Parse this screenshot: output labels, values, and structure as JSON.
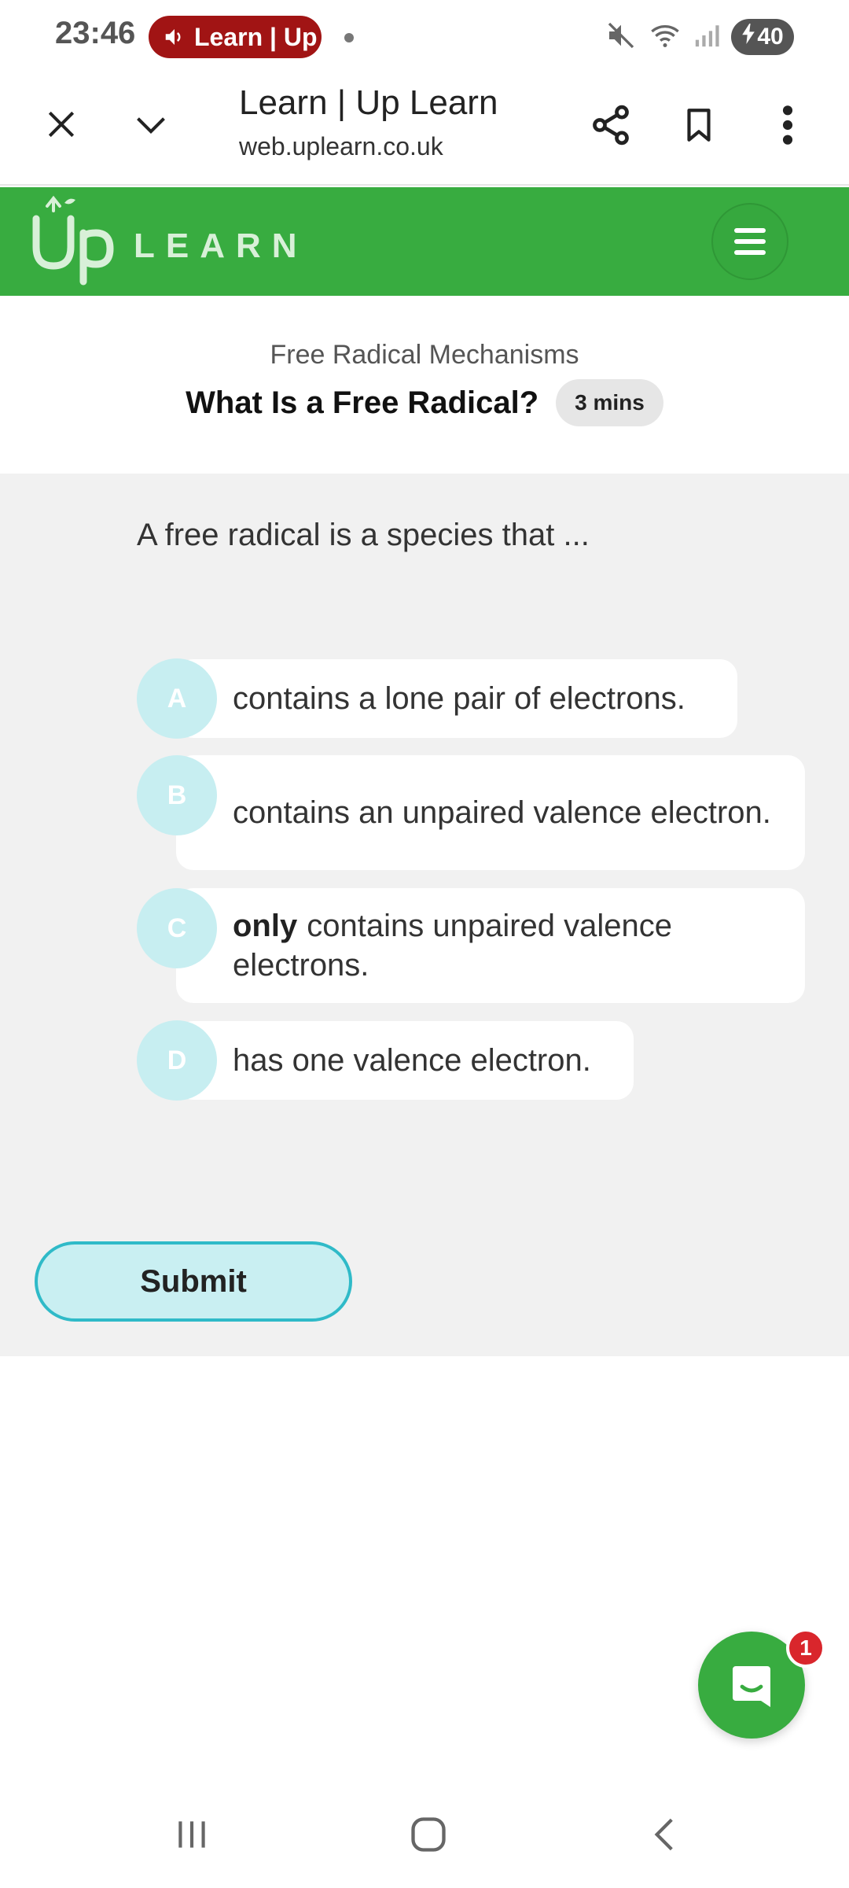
{
  "status_bar": {
    "time": "23:46",
    "media_label": "Learn | Up",
    "battery": "40"
  },
  "browser": {
    "page_title": "Learn | Up Learn",
    "url": "web.uplearn.co.uk"
  },
  "app_header": {
    "logo_word": "LEARN",
    "brand_color": "#38ac40"
  },
  "lesson": {
    "topic": "Free Radical Mechanisms",
    "title": "What Is a Free Radical?",
    "duration": "3 mins"
  },
  "question": {
    "prompt": "A free radical is a species that ...",
    "options": [
      {
        "letter": "A",
        "emphasis": "",
        "text": "contains a lone pair of electrons."
      },
      {
        "letter": "B",
        "emphasis": "",
        "text": "contains an unpaired valence electron."
      },
      {
        "letter": "C",
        "emphasis": "only",
        "text": "contains unpaired valence electrons."
      },
      {
        "letter": "D",
        "emphasis": "",
        "text": "has one valence electron."
      }
    ],
    "submit_label": "Submit"
  },
  "chat": {
    "unread_count": "1"
  }
}
